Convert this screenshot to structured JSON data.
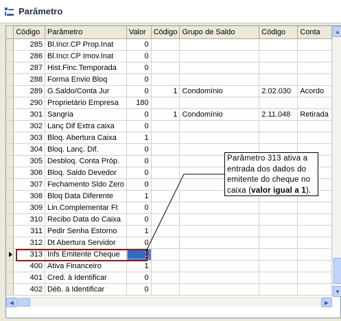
{
  "window": {
    "title": "Parâmetro",
    "icon": "parameter-window-icon"
  },
  "grid": {
    "columns": [
      "Código",
      "Parâmetro",
      "Valor",
      "Código",
      "Grupo de Saldo",
      "Código",
      "Conta"
    ],
    "rows": [
      {
        "codigo": "285",
        "parametro": "Bl.Incr.CP Prop.Inat",
        "valor": "0",
        "codigo2": "",
        "grupo": "",
        "codigo3": "",
        "conta": ""
      },
      {
        "codigo": "286",
        "parametro": "Bl.Incr.CP Imov.Inat",
        "valor": "0",
        "codigo2": "",
        "grupo": "",
        "codigo3": "",
        "conta": ""
      },
      {
        "codigo": "287",
        "parametro": "Hist.Finc.Temporada",
        "valor": "0",
        "codigo2": "",
        "grupo": "",
        "codigo3": "",
        "conta": ""
      },
      {
        "codigo": "288",
        "parametro": "Forma Envio Bloq",
        "valor": "0",
        "codigo2": "",
        "grupo": "",
        "codigo3": "",
        "conta": ""
      },
      {
        "codigo": "289",
        "parametro": "G.Saldo/Conta Jur",
        "valor": "0",
        "codigo2": "1",
        "grupo": "Condomínio",
        "codigo3": "2.02.030",
        "conta": "Acordo"
      },
      {
        "codigo": "290",
        "parametro": "Proprietário Empresa",
        "valor": "180",
        "codigo2": "",
        "grupo": "",
        "codigo3": "",
        "conta": ""
      },
      {
        "codigo": "301",
        "parametro": "Sangria",
        "valor": "0",
        "codigo2": "1",
        "grupo": "Condomínio",
        "codigo3": "2.11.048",
        "conta": "Retirada"
      },
      {
        "codigo": "302",
        "parametro": "Lanç Dif Extra caixa",
        "valor": "0",
        "codigo2": "",
        "grupo": "",
        "codigo3": "",
        "conta": ""
      },
      {
        "codigo": "303",
        "parametro": "Bloq. Abertura Caixa",
        "valor": "1",
        "codigo2": "",
        "grupo": "",
        "codigo3": "",
        "conta": ""
      },
      {
        "codigo": "304",
        "parametro": "Bloq. Lanç. Dif.",
        "valor": "0",
        "codigo2": "",
        "grupo": "",
        "codigo3": "",
        "conta": ""
      },
      {
        "codigo": "305",
        "parametro": "Desbloq. Conta Próp.",
        "valor": "0",
        "codigo2": "",
        "grupo": "",
        "codigo3": "",
        "conta": ""
      },
      {
        "codigo": "306",
        "parametro": "Bloq. Saldo Devedor",
        "valor": "0",
        "codigo2": "",
        "grupo": "",
        "codigo3": "",
        "conta": ""
      },
      {
        "codigo": "307",
        "parametro": "Fechamento Sldo Zero",
        "valor": "0",
        "codigo2": "",
        "grupo": "",
        "codigo3": "",
        "conta": ""
      },
      {
        "codigo": "308",
        "parametro": "Bloq Data Diferente",
        "valor": "1",
        "codigo2": "",
        "grupo": "",
        "codigo3": "",
        "conta": ""
      },
      {
        "codigo": "309",
        "parametro": "Lin.Complementar Ft",
        "valor": "0",
        "codigo2": "",
        "grupo": "",
        "codigo3": "",
        "conta": ""
      },
      {
        "codigo": "310",
        "parametro": "Recibo Data do Caixa",
        "valor": "0",
        "codigo2": "",
        "grupo": "",
        "codigo3": "",
        "conta": ""
      },
      {
        "codigo": "311",
        "parametro": "Pedir Senha Estorno",
        "valor": "1",
        "codigo2": "",
        "grupo": "",
        "codigo3": "",
        "conta": ""
      },
      {
        "codigo": "312",
        "parametro": "Dt Abertura Servidor",
        "valor": "0",
        "codigo2": "",
        "grupo": "",
        "codigo3": "",
        "conta": ""
      },
      {
        "codigo": "313",
        "parametro": "Infs Emitente Cheque",
        "valor": "1",
        "codigo2": "",
        "grupo": "",
        "codigo3": "",
        "conta": ""
      },
      {
        "codigo": "400",
        "parametro": "Ativa Financeiro",
        "valor": "1",
        "codigo2": "",
        "grupo": "",
        "codigo3": "",
        "conta": ""
      },
      {
        "codigo": "401",
        "parametro": "Cred. à Identificar",
        "valor": "0",
        "codigo2": "",
        "grupo": "",
        "codigo3": "",
        "conta": ""
      },
      {
        "codigo": "402",
        "parametro": "Déb. à Identificar",
        "valor": "0",
        "codigo2": "",
        "grupo": "",
        "codigo3": "",
        "conta": ""
      }
    ],
    "selected_row_index": 18
  },
  "callout": {
    "text_before": "Parâmetro 313 ativa a entrada dos dados do emitente do cheque no caixa (",
    "text_bold": "valor igual a 1",
    "text_after": ")."
  },
  "colors": {
    "selection": "#316ac5",
    "highlight_border": "#8b1a1a",
    "header_bg": "#ece9d8"
  }
}
